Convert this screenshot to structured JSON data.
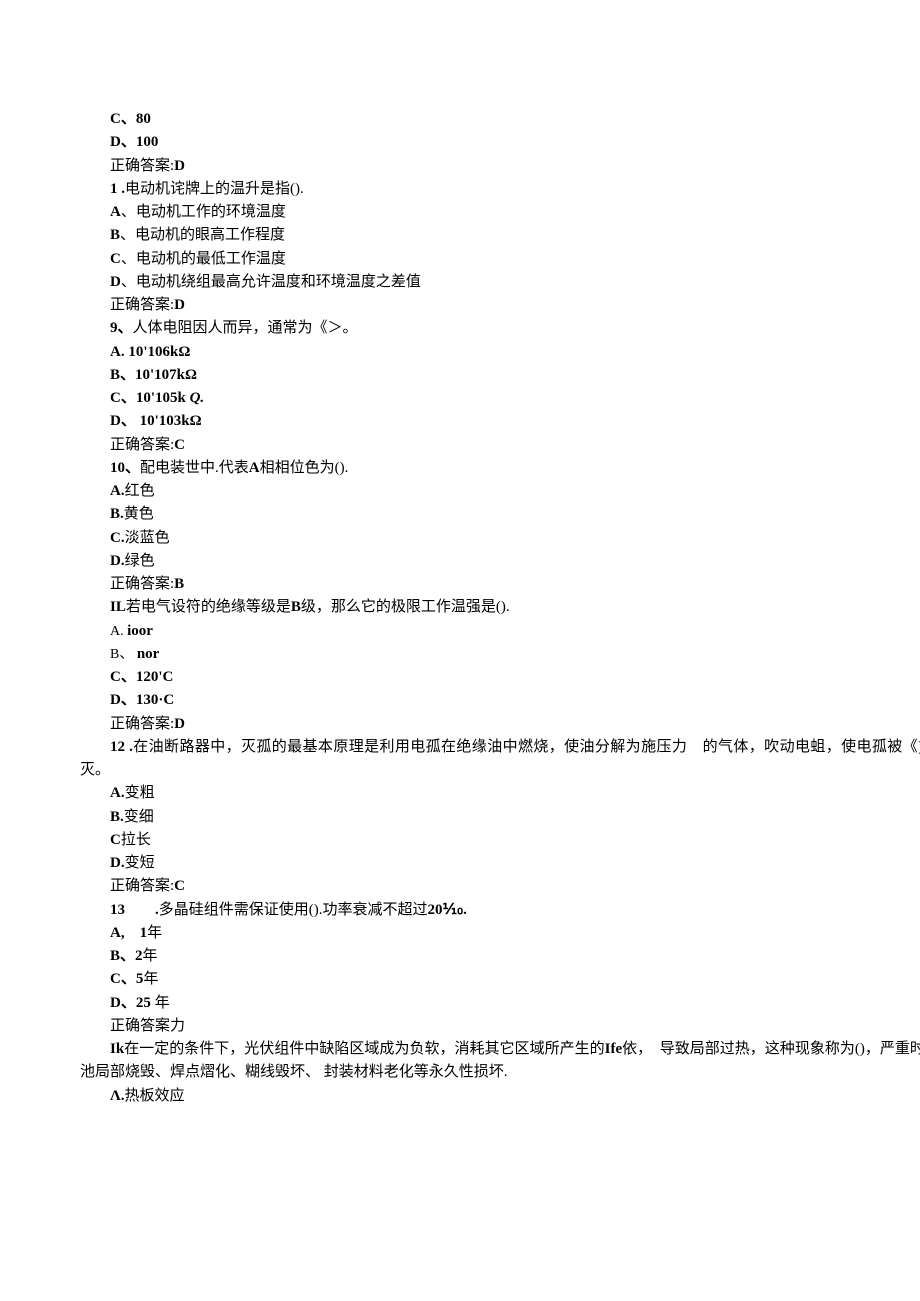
{
  "top": {
    "c": "C、80",
    "d": "D、100",
    "ans": "正确答案:D"
  },
  "q1": {
    "stem_label": "1 .",
    "stem_text": "电动机诧牌上的温升是指().",
    "a": "A、电动机工作的环境温度",
    "b": "B、电动机的眼高工作程度",
    "c": "C、电动机的最低工作温度",
    "d": "D、电动机绕组最高允许温度和环境温度之差值",
    "ans": "正确答案:D"
  },
  "q9": {
    "stem_label": "9、",
    "stem_text": "人体电阻因人而异，通常为《＞。",
    "a": "A. 10'106kΩ",
    "b": "B、10'107kΩ",
    "c_prefix": "C、10'105k ",
    "c_suffix": "Q.",
    "d": "D、 10'103kΩ",
    "ans": "正确答案:C"
  },
  "q10": {
    "stem_label": "10、",
    "stem_text_a": "配电装世中.代表",
    "stem_text_b": "A",
    "stem_text_c": "相相位色为().",
    "a_label": "A.",
    "a_text": "红色",
    "b_label": "B.",
    "b_text": "黄色",
    "c_label": "C.",
    "c_text": "淡蓝色",
    "d_label": "D.",
    "d_text": "绿色",
    "ans": "正确答案:B"
  },
  "qIL": {
    "stem_label": "IL",
    "stem_text_a": "若电气设符的绝缘等级是",
    "stem_text_b": "B",
    "stem_text_c": "级，那么它的极限工作温强是().",
    "a_prefix": "A. ",
    "a_text": "ioor",
    "b_prefix": "B、 ",
    "b_text": "nor",
    "c": "C、120'C",
    "d": "D、130·C",
    "ans": "正确答案:D"
  },
  "q12": {
    "stem_label": "12 .",
    "stem_text": "在油断路器中，灭孤的最基本原理是利用电孤在绝缘油中燃烧，使油分解为施压力　的气体，吹动电蛆，使电孤被《)冷却以后炮灭。",
    "a_label": "A.",
    "a_text": "变粗",
    "b_label": "B.",
    "b_text": "变细",
    "c_label": "C",
    "c_text": "拉长",
    "d_label": "D.",
    "d_text": "变短",
    "ans": "正确答案:C"
  },
  "q13": {
    "stem_label": "13　　.",
    "stem_text_a": "多晶硅组件需保证使用().功率衰减不超过",
    "stem_text_b": "20⅒.",
    "a_label": "A,　1",
    "a_text": "年",
    "b_label": "B、2",
    "b_text": "年",
    "c_label": "C、5",
    "c_text": "年",
    "d_label": "D、25",
    "d_text": " 年",
    "ans": "正确答案力"
  },
  "qIk": {
    "stem_label": "Ik",
    "stem_text_a": "在一定的条件下，光伏组件中缺陷区域成为负软，消耗其它区域所产生的",
    "stem_text_b": "Ife",
    "stem_text_c": "依，　导致局部过热，这种现象称为()，严重时，会等致电池局部烧毁、焊点熠化、糊线毁坏、 封装材料老化等永久性损坏.",
    "a_label": "Λ.",
    "a_text": "热板效应"
  }
}
